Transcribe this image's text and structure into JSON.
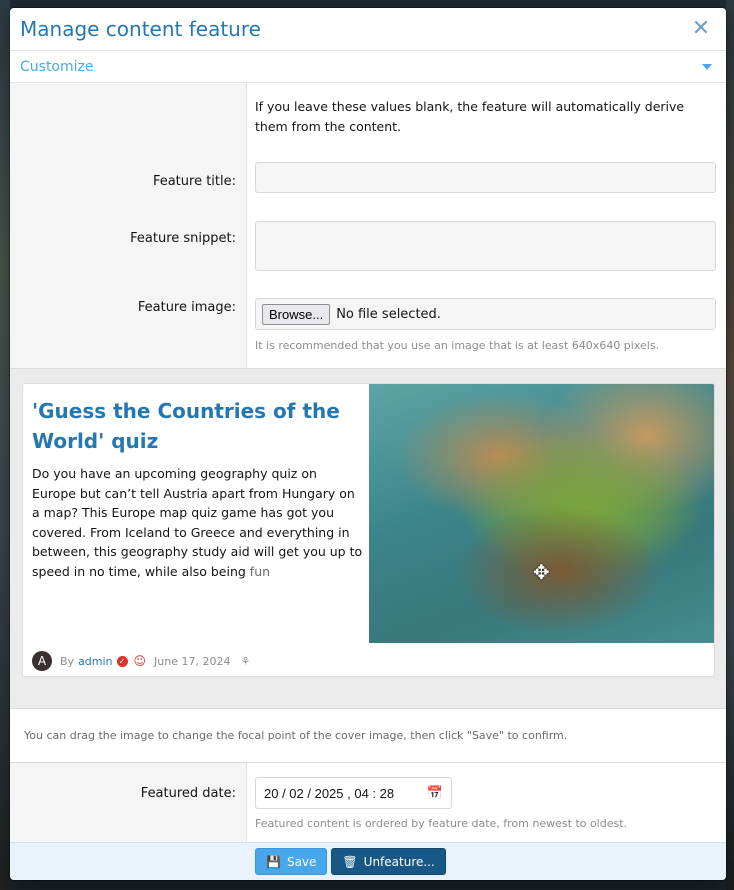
{
  "dialog": {
    "title": "Manage content feature",
    "close_icon": "close-icon"
  },
  "tab": {
    "label": "Customize",
    "chevron_icon": "chevron-down-icon"
  },
  "intro": "If you leave these values blank, the feature will automatically derive them from the content.",
  "fields": {
    "title_label": "Feature title:",
    "title_value": "",
    "snippet_label": "Feature snippet:",
    "snippet_value": "",
    "image_label": "Feature image:",
    "browse_label": "Browse...",
    "no_file": "No file selected.",
    "image_hint": "It is recommended that you use an image that is at least 640x640 pixels."
  },
  "preview": {
    "title": "'Guess the Countries of the World' quiz",
    "snippet": "Do you have an upcoming geography quiz on Europe but can’t tell Austria apart from Hungary on a map? This Europe map quiz game has got you covered. From Iceland to Greece and everything in between, this geography study aid will get you up to speed in no time, while also being",
    "snippet_fade": "fun",
    "avatar_letter": "A",
    "by": "By",
    "author": "admin",
    "date": "June 17, 2024",
    "drag_note": "You can drag the image to change the focal point of the cover image, then click \"Save\" to confirm."
  },
  "featured_date": {
    "label": "Featured date:",
    "value": "20 / 02 / 2025 ,  04 : 28",
    "hint": "Featured content is ordered by feature date, from newest to oldest."
  },
  "buttons": {
    "save": "Save",
    "unfeature": "Unfeature..."
  },
  "colors": {
    "accent": "#2577b1",
    "light_accent": "#47a7eb",
    "danger": "#e0302a",
    "unfeature_bg": "#185886"
  }
}
